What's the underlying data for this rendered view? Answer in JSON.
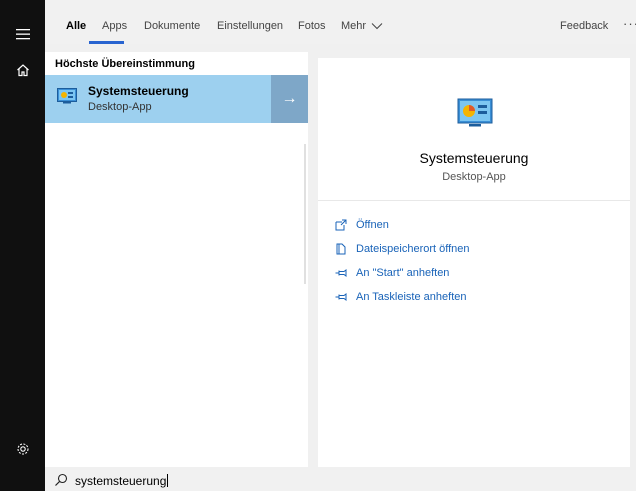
{
  "tabs": [
    {
      "label": "Alle",
      "active": true
    },
    {
      "label": "Apps"
    },
    {
      "label": "Dokumente"
    },
    {
      "label": "Einstellungen"
    },
    {
      "label": "Fotos"
    }
  ],
  "mehr_label": "Mehr",
  "feedback_label": "Feedback",
  "more_label": "···",
  "results": {
    "section_title": "Höchste Übereinstimmung",
    "best_match": {
      "title": "Systemsteuerung",
      "subtitle": "Desktop-App",
      "arrow": "→"
    }
  },
  "detail": {
    "title": "Systemsteuerung",
    "subtitle": "Desktop-App",
    "actions": [
      {
        "label": "Öffnen",
        "icon": "open-icon"
      },
      {
        "label": "Dateispeicherort öffnen",
        "icon": "file-location-icon"
      },
      {
        "label": "An \"Start\" anheften",
        "icon": "pin-icon"
      },
      {
        "label": "An Taskleiste anheften",
        "icon": "pin-icon"
      }
    ]
  },
  "search": {
    "value": "systemsteuerung"
  },
  "colors": {
    "accent": "#2864d0",
    "selection": "#9dd0ef",
    "link": "#1963b8",
    "rail": "#101010"
  }
}
